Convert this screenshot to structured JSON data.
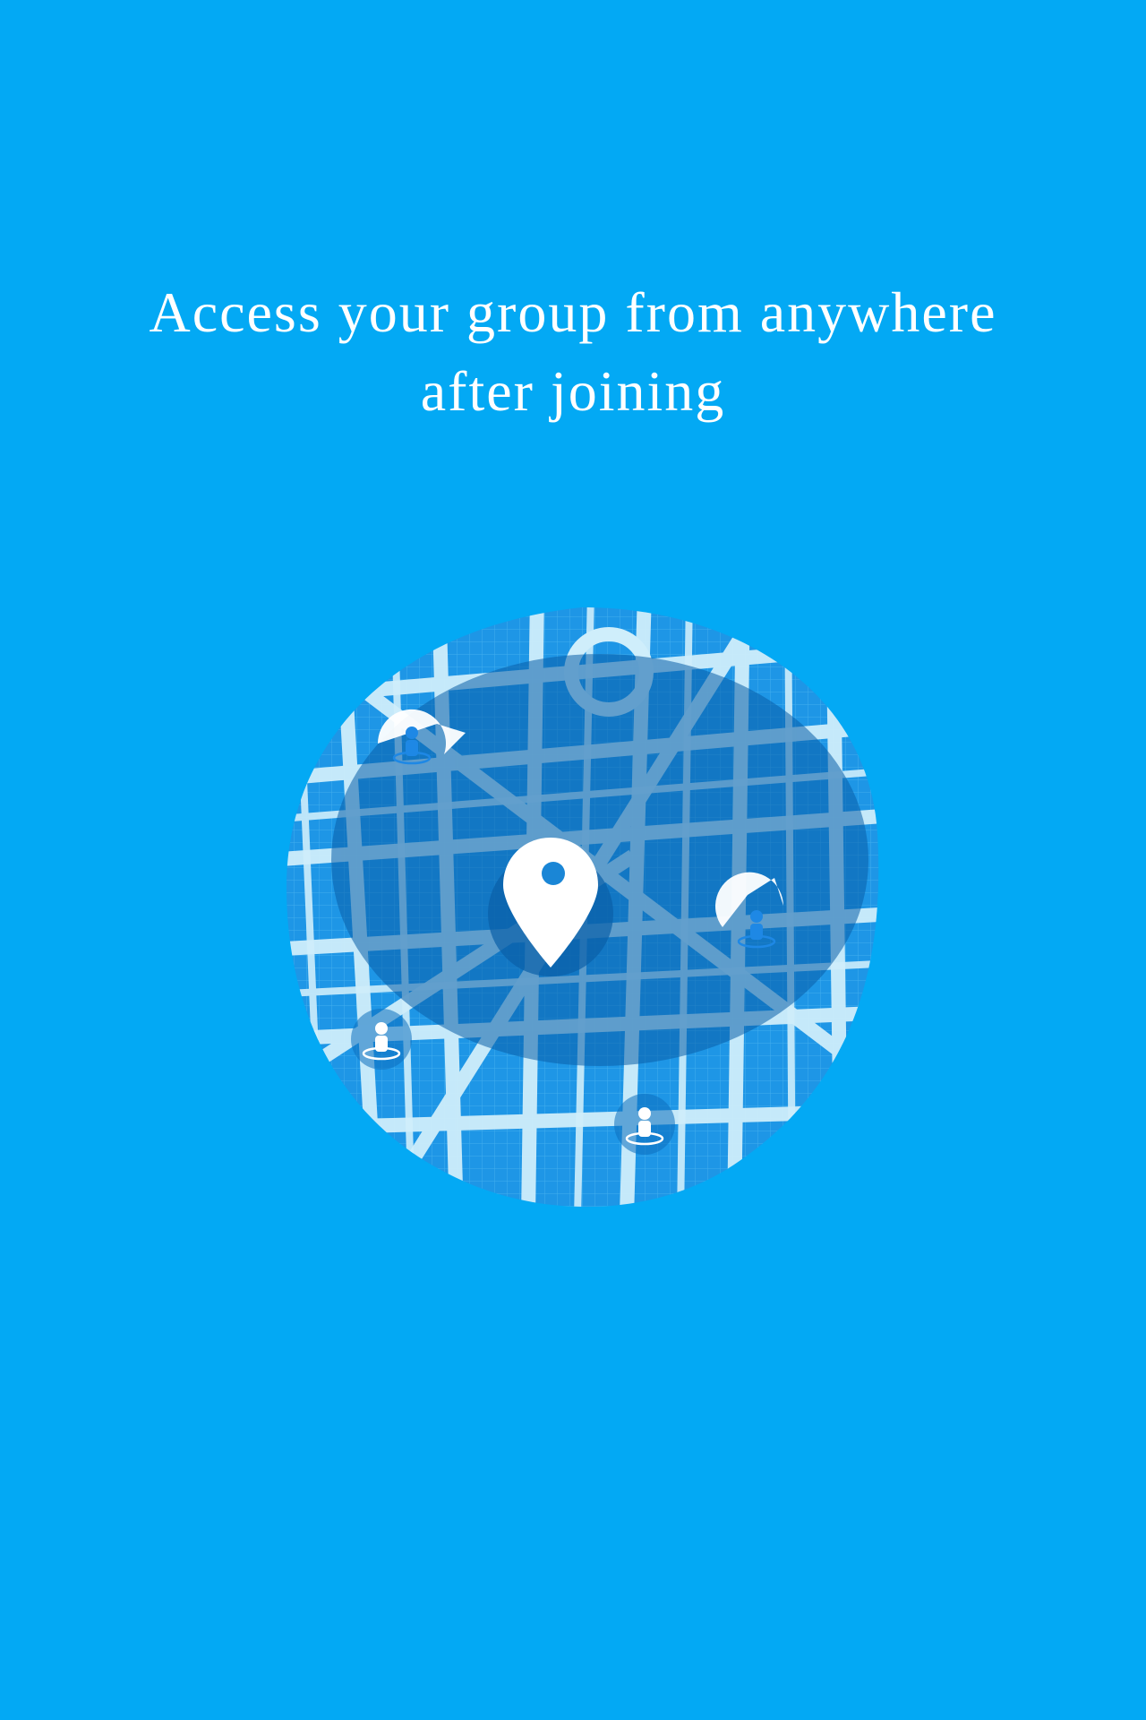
{
  "onboarding": {
    "headline_line1": "Access your group from anywhere",
    "headline_line2": "after joining"
  },
  "illustration": {
    "type": "city-map",
    "center_marker_icon": "location-pin-icon",
    "member_marker_icon": "person-marker-icon",
    "member_marker_count": 4
  },
  "colors": {
    "background": "#03a9f4",
    "map_water": "#1c8fe0",
    "map_street": "#bfe6f7",
    "map_radius": "#0a6fb8",
    "marker_white": "#ffffff",
    "marker_accent": "#1e88e5"
  }
}
